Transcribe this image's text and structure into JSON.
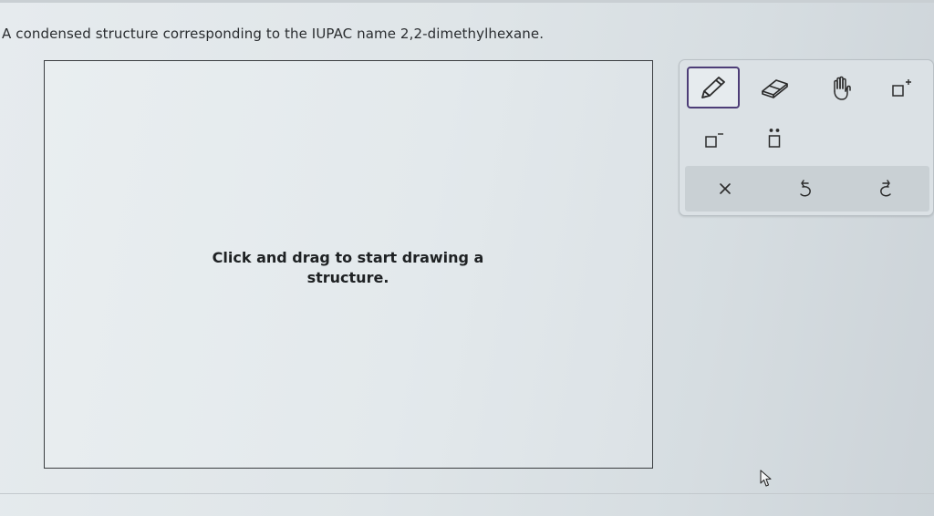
{
  "question": {
    "text": "A condensed structure corresponding to the IUPAC name 2,2-dimethylhexane."
  },
  "canvas": {
    "hint": "Click and drag to start drawing a structure."
  },
  "toolbar": {
    "tools": [
      {
        "icon": "pencil-icon",
        "selected": true
      },
      {
        "icon": "eraser-icon",
        "selected": false
      },
      {
        "icon": "hand-icon",
        "selected": false
      },
      {
        "icon": "positive-charge-icon",
        "selected": false
      },
      {
        "icon": "negative-charge-icon",
        "selected": false
      },
      {
        "icon": "lone-pair-icon",
        "selected": false
      }
    ],
    "actions": [
      {
        "icon": "clear-icon"
      },
      {
        "icon": "undo-icon"
      },
      {
        "icon": "redo-icon"
      }
    ],
    "accent_color": "#4d3d77"
  }
}
